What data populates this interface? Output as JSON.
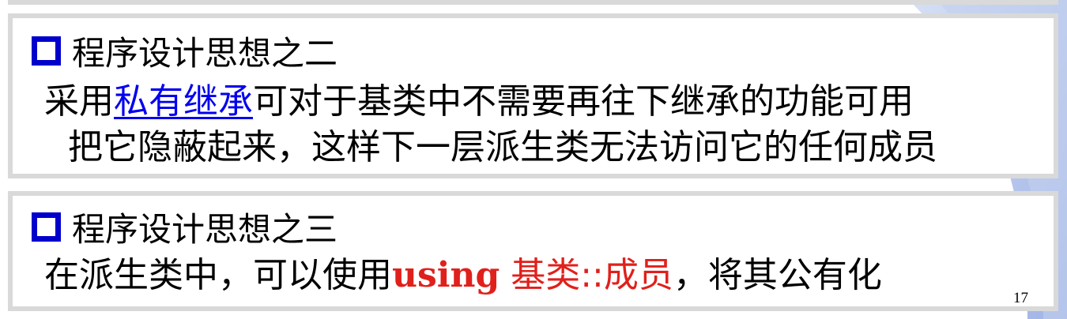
{
  "slide": {
    "section_two": {
      "heading": "程序设计思想之二",
      "line1_before": "采用",
      "line1_link": "私有继承",
      "line1_after": "可对于基类中不需要再往下继承的功能可用",
      "line2": "把它隐蔽起来，这样下一层派生类无法访问它的任何成员"
    },
    "section_three": {
      "heading": "程序设计思想之三",
      "body_before": "在派生类中，可以使用",
      "body_keyword": "using",
      "body_red_rest": " 基类::成员",
      "body_after": "，将其公有化"
    },
    "page_number": "17"
  },
  "colors": {
    "bullet": "#0000cc",
    "link": "#0000ee",
    "highlight_red": "#e0201b",
    "panel_border": "#d9d9d9",
    "decoration_blue": "#aebfe6"
  }
}
